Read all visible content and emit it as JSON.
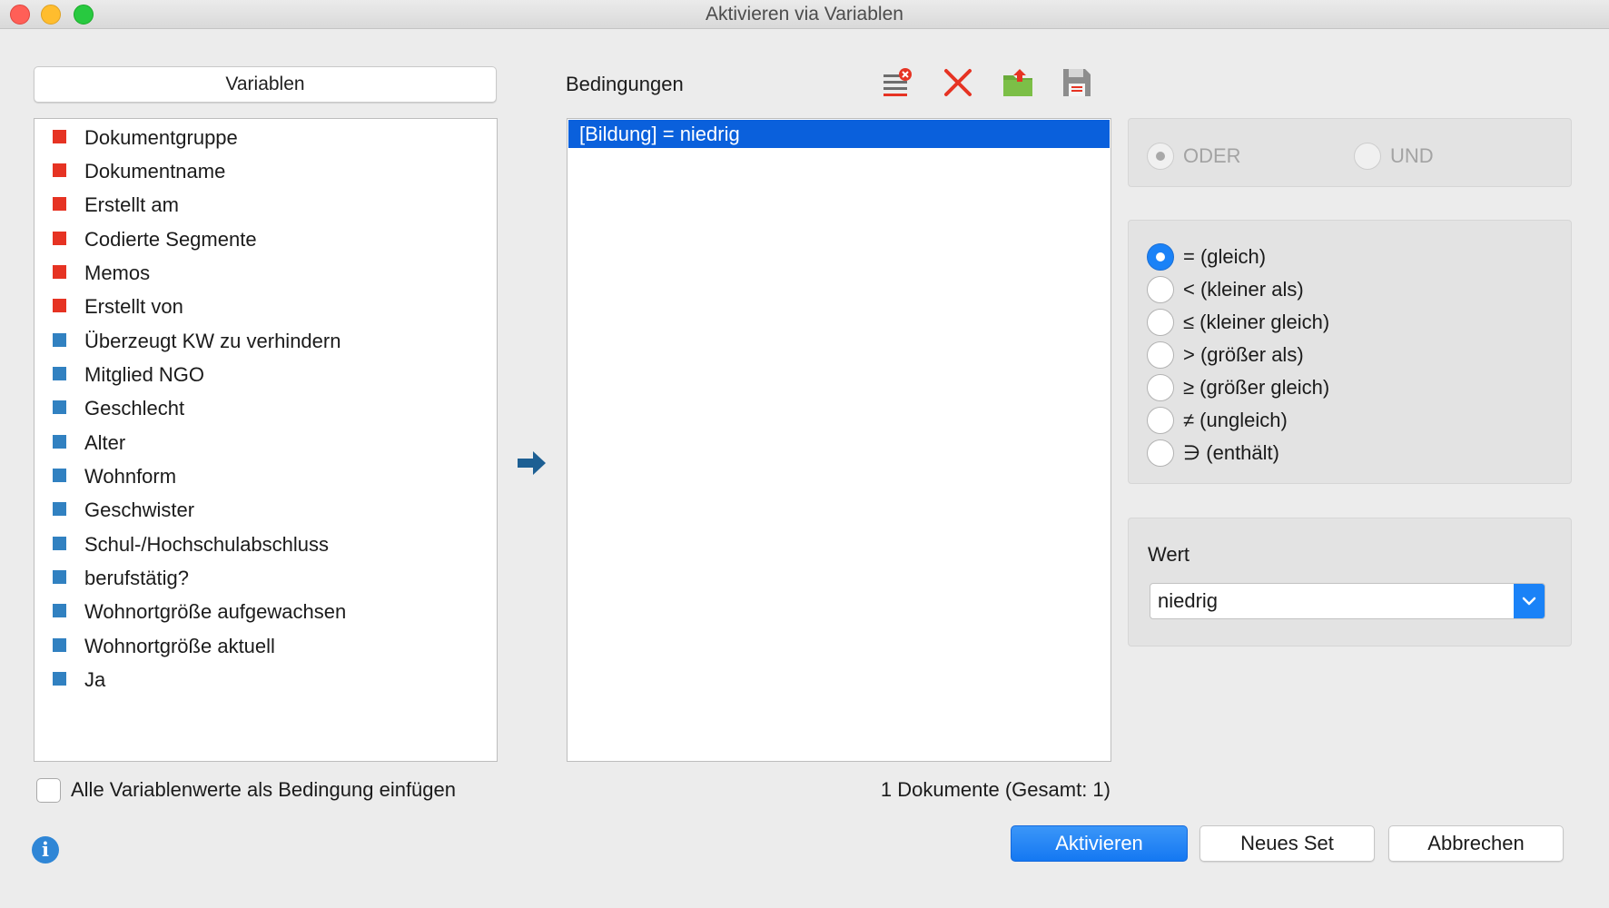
{
  "window": {
    "title": "Aktivieren via Variablen"
  },
  "left": {
    "variables_button": "Variablen",
    "variables": [
      {
        "label": "Dokumentgruppe",
        "color": "#e63323"
      },
      {
        "label": "Dokumentname",
        "color": "#e63323"
      },
      {
        "label": "Erstellt am",
        "color": "#e63323"
      },
      {
        "label": "Codierte Segmente",
        "color": "#e63323"
      },
      {
        "label": "Memos",
        "color": "#e63323"
      },
      {
        "label": "Erstellt von",
        "color": "#e63323"
      },
      {
        "label": "Überzeugt KW zu verhindern",
        "color": "#3181c1"
      },
      {
        "label": "Mitglied NGO",
        "color": "#3181c1"
      },
      {
        "label": "Geschlecht",
        "color": "#3181c1"
      },
      {
        "label": "Alter",
        "color": "#3181c1"
      },
      {
        "label": "Wohnform",
        "color": "#3181c1"
      },
      {
        "label": "Geschwister",
        "color": "#3181c1"
      },
      {
        "label": "Schul-/Hochschulabschluss",
        "color": "#3181c1"
      },
      {
        "label": "berufstätig?",
        "color": "#3181c1"
      },
      {
        "label": "Wohnortgröße aufgewachsen",
        "color": "#3181c1"
      },
      {
        "label": "Wohnortgröße aktuell",
        "color": "#3181c1"
      },
      {
        "label": "Ja",
        "color": "#3181c1"
      }
    ],
    "insert_all_checkbox": {
      "label": "Alle Variablenwerte als Bedingung einfügen",
      "checked": false
    }
  },
  "conditions": {
    "title": "Bedingungen",
    "toolbar": [
      "clear-list-icon",
      "delete-icon",
      "open-folder-icon",
      "save-icon"
    ],
    "items": [
      {
        "text": "[Bildung] = niedrig",
        "selected": true
      }
    ],
    "count_text": "1 Dokumente (Gesamt: 1)"
  },
  "logic": {
    "options": [
      {
        "label": "ODER",
        "selected": true,
        "disabled": true
      },
      {
        "label": "UND",
        "selected": false,
        "disabled": true
      }
    ]
  },
  "operators": [
    {
      "label": "= (gleich)",
      "selected": true
    },
    {
      "label": "< (kleiner als)",
      "selected": false
    },
    {
      "label": "≤ (kleiner gleich)",
      "selected": false
    },
    {
      "label": "> (größer als)",
      "selected": false
    },
    {
      "label": "≥ (größer gleich)",
      "selected": false
    },
    {
      "label": "≠ (ungleich)",
      "selected": false
    },
    {
      "label": "∋ (enthält)",
      "selected": false
    }
  ],
  "value": {
    "label": "Wert",
    "selected": "niedrig"
  },
  "buttons": {
    "activate": "Aktivieren",
    "new_set": "Neues Set",
    "cancel": "Abbrechen"
  },
  "colors": {
    "accent": "#1a82f7",
    "selection": "#0a60dc",
    "doc_var": "#e63323",
    "user_var": "#3181c1"
  }
}
